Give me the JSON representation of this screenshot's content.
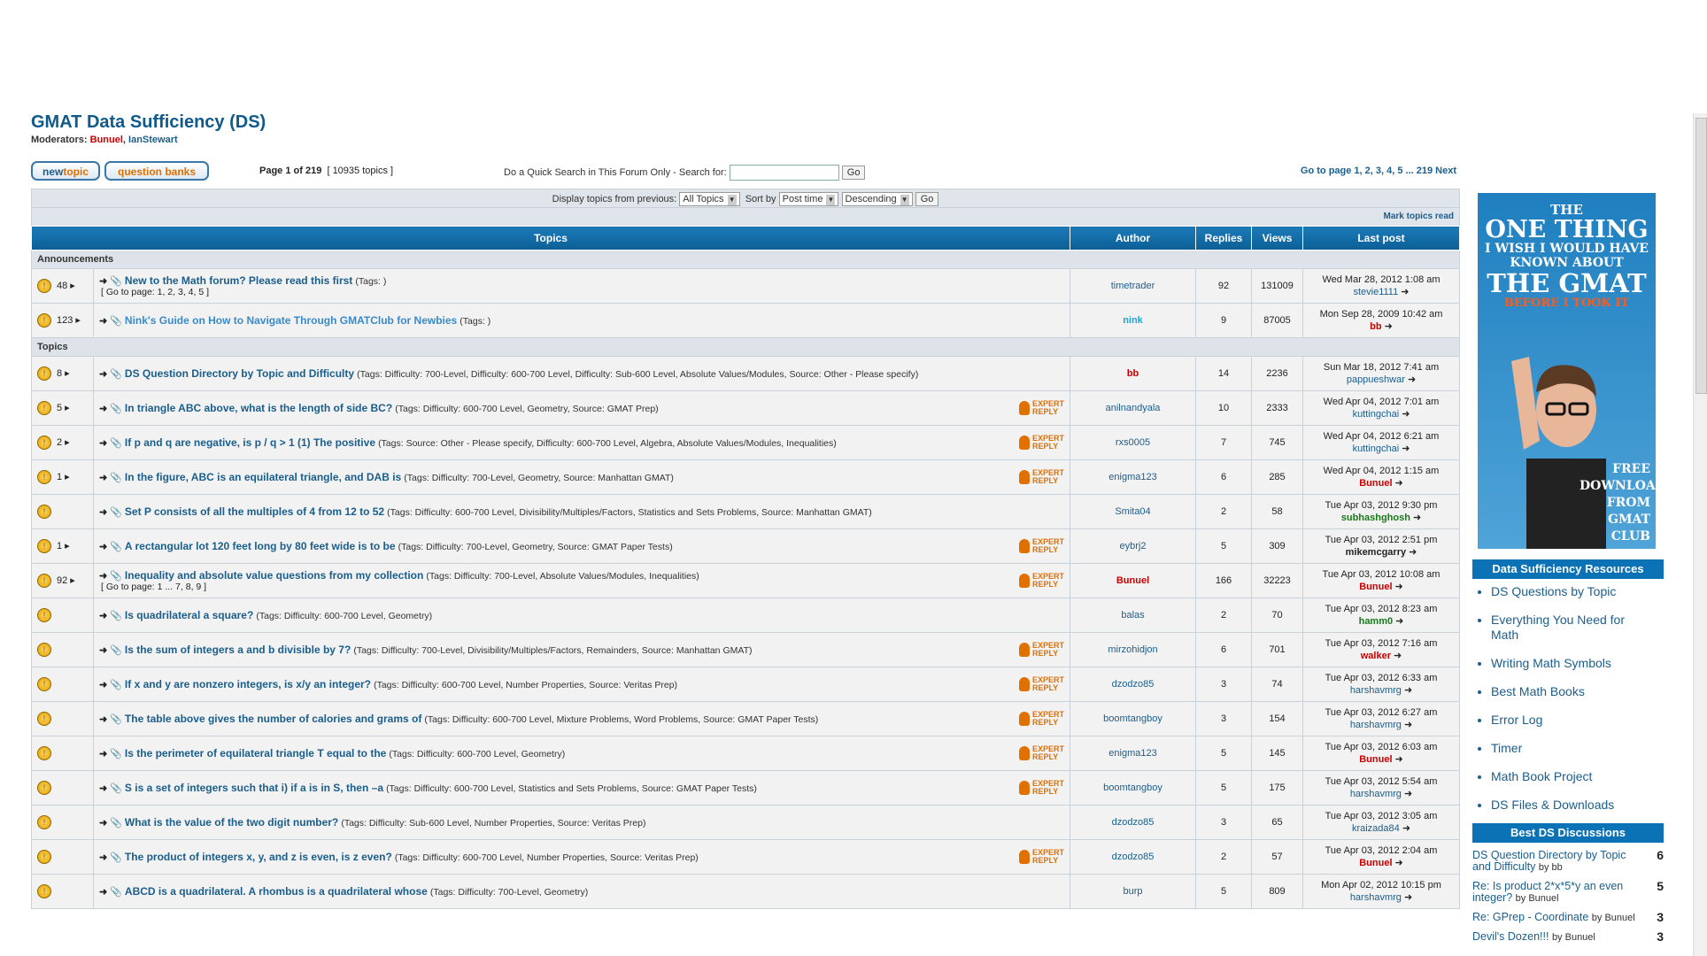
{
  "forum": {
    "title": "GMAT Data Sufficiency (DS)",
    "moderators_label": "Moderators:",
    "moderators": [
      "Bunuel",
      "IanStewart"
    ]
  },
  "buttons": {
    "newtopic_a": "new",
    "newtopic_b": "topic",
    "question_banks": "question banks"
  },
  "pageinfo": {
    "page_label": "Page 1 of 219",
    "topics_count": "[ 10935 topics ]"
  },
  "quicksearch": {
    "label": "Do a Quick Search in This Forum Only -  Search for:",
    "go": "Go"
  },
  "goto": {
    "text": "Go to page 1, 2, 3, 4, 5 ... 219  Next"
  },
  "filter": {
    "display_label": "Display topics from previous:",
    "period": "All Topics",
    "sort_label": "Sort by",
    "sort_by": "Post time",
    "order": "Descending",
    "go": "Go"
  },
  "mark_read": "Mark topics read",
  "columns": {
    "topics": "Topics",
    "author": "Author",
    "replies": "Replies",
    "views": "Views",
    "last_post": "Last post"
  },
  "sections": {
    "announcements": "Announcements",
    "topics": "Topics"
  },
  "announcements": [
    {
      "num": "48",
      "title": "New to the Math forum? Please read this first",
      "tags": "(Tags: )",
      "pages": "[ Go to page: 1, 2, 3, 4, 5 ]",
      "author": "timetrader",
      "replies": "92",
      "views": "131009",
      "date": "Wed Mar 28, 2012 1:08 am",
      "last_user": "stevie1111"
    },
    {
      "num": "123",
      "title": "Nink's Guide on How to Navigate Through GMATClub for Newbies",
      "tags": "(Tags: )",
      "author": "nink",
      "replies": "9",
      "views": "87005",
      "date": "Mon Sep 28, 2009 10:42 am",
      "last_user": "bb"
    }
  ],
  "topics": [
    {
      "num": "8",
      "title": "DS Question Directory by Topic and Difficulty",
      "tags": "(Tags: Difficulty: 700-Level, Difficulty: 600-700 Level, Difficulty: Sub-600 Level, Absolute Values/Modules, Source: Other - Please specify)",
      "expert": false,
      "author": "bb",
      "replies": "14",
      "views": "2236",
      "date": "Sun Mar 18, 2012 7:41 am",
      "last_user": "pappueshwar"
    },
    {
      "num": "5",
      "title": "In triangle ABC above, what is the length of side BC?",
      "tags": "(Tags: Difficulty: 600-700 Level, Geometry, Source: GMAT Prep)",
      "expert": true,
      "author": "anilnandyala",
      "replies": "10",
      "views": "2333",
      "date": "Wed Apr 04, 2012 7:01 am",
      "last_user": "kuttingchai"
    },
    {
      "num": "2",
      "title": "If p and q are negative, is p / q > 1 (1) The positive",
      "tags": "(Tags: Source: Other - Please specify, Difficulty: 600-700 Level, Algebra, Absolute Values/Modules, Inequalities)",
      "expert": true,
      "author": "rxs0005",
      "replies": "7",
      "views": "745",
      "date": "Wed Apr 04, 2012 6:21 am",
      "last_user": "kuttingchai"
    },
    {
      "num": "1",
      "title": "In the figure, ABC is an equilateral triangle, and DAB is",
      "tags": "(Tags: Difficulty: 700-Level, Geometry, Source: Manhattan GMAT)",
      "expert": true,
      "author": "enigma123",
      "replies": "6",
      "views": "285",
      "date": "Wed Apr 04, 2012 1:15 am",
      "last_user": "Bunuel"
    },
    {
      "num": "",
      "title": "Set P consists of all the multiples of 4 from 12 to 52",
      "tags": "(Tags: Difficulty: 600-700 Level, Divisibility/Multiples/Factors, Statistics and Sets Problems, Source: Manhattan GMAT)",
      "expert": false,
      "author": "Smita04",
      "replies": "2",
      "views": "58",
      "date": "Tue Apr 03, 2012 9:30 pm",
      "last_user": "subhashghosh"
    },
    {
      "num": "1",
      "title": "A rectangular lot 120 feet long by 80 feet wide is to be",
      "tags": "(Tags: Difficulty: 700-Level, Geometry, Source: GMAT Paper Tests)",
      "expert": true,
      "author": "eybrj2",
      "replies": "5",
      "views": "309",
      "date": "Tue Apr 03, 2012 2:51 pm",
      "last_user": "mikemcgarry"
    },
    {
      "num": "92",
      "title": "Inequality and absolute value questions from my collection",
      "tags": "(Tags: Difficulty: 700-Level, Absolute Values/Modules, Inequalities)",
      "pages": "[ Go to page: 1 ... 7, 8, 9 ]",
      "expert": true,
      "author": "Bunuel",
      "replies": "166",
      "views": "32223",
      "date": "Tue Apr 03, 2012 10:08 am",
      "last_user": "Bunuel"
    },
    {
      "num": "",
      "title": "Is quadrilateral a square?",
      "tags": "(Tags: Difficulty: 600-700 Level, Geometry)",
      "expert": false,
      "author": "balas",
      "replies": "2",
      "views": "70",
      "date": "Tue Apr 03, 2012 8:23 am",
      "last_user": "hamm0"
    },
    {
      "num": "",
      "title": "Is the sum of integers a and b divisible by 7?",
      "tags": "(Tags: Difficulty: 700-Level, Divisibility/Multiples/Factors, Remainders, Source: Manhattan GMAT)",
      "expert": true,
      "author": "mirzohidjon",
      "replies": "6",
      "views": "701",
      "date": "Tue Apr 03, 2012 7:16 am",
      "last_user": "walker"
    },
    {
      "num": "",
      "title": "If x and y are nonzero integers, is x/y an integer?",
      "tags": "(Tags: Difficulty: 600-700 Level, Number Properties, Source: Veritas Prep)",
      "expert": true,
      "author": "dzodzo85",
      "replies": "3",
      "views": "74",
      "date": "Tue Apr 03, 2012 6:33 am",
      "last_user": "harshavmrg"
    },
    {
      "num": "",
      "title": "The table above gives the number of calories and grams of",
      "tags": "(Tags: Difficulty: 600-700 Level, Mixture Problems, Word Problems, Source: GMAT Paper Tests)",
      "expert": true,
      "author": "boomtangboy",
      "replies": "3",
      "views": "154",
      "date": "Tue Apr 03, 2012 6:27 am",
      "last_user": "harshavmrg"
    },
    {
      "num": "",
      "title": "Is the perimeter of equilateral triangle T equal to the",
      "tags": "(Tags: Difficulty: 600-700 Level, Geometry)",
      "expert": true,
      "author": "enigma123",
      "replies": "5",
      "views": "145",
      "date": "Tue Apr 03, 2012 6:03 am",
      "last_user": "Bunuel"
    },
    {
      "num": "",
      "title": "S is a set of integers such that i) if a is in S, then –a",
      "tags": "(Tags: Difficulty: 600-700 Level, Statistics and Sets Problems, Source: GMAT Paper Tests)",
      "expert": true,
      "author": "boomtangboy",
      "replies": "5",
      "views": "175",
      "date": "Tue Apr 03, 2012 5:54 am",
      "last_user": "harshavmrg"
    },
    {
      "num": "",
      "title": "What is the value of the two digit number?",
      "tags": "(Tags: Difficulty: Sub-600 Level, Number Properties, Source: Veritas Prep)",
      "expert": false,
      "author": "dzodzo85",
      "replies": "3",
      "views": "65",
      "date": "Tue Apr 03, 2012 3:05 am",
      "last_user": "kraizada84"
    },
    {
      "num": "",
      "title": "The product of integers x, y, and z is even, is z even?",
      "tags": "(Tags: Difficulty: 600-700 Level, Number Properties, Source: Veritas Prep)",
      "expert": true,
      "author": "dzodzo85",
      "replies": "2",
      "views": "57",
      "date": "Tue Apr 03, 2012 2:04 am",
      "last_user": "Bunuel"
    },
    {
      "num": "",
      "title": "ABCD is a quadrilateral. A rhombus is a quadrilateral whose",
      "tags": "(Tags: Difficulty: 700-Level, Geometry)",
      "expert": false,
      "author": "burp",
      "replies": "5",
      "views": "809",
      "date": "Mon Apr 02, 2012 10:15 pm",
      "last_user": "harshavmrg"
    }
  ],
  "expert_reply": "EXPERT REPLY",
  "ad": {
    "line1": "THE",
    "line2": "ONE THING",
    "line3": "I WISH I WOULD HAVE KNOWN ABOUT",
    "line4": "THE GMAT",
    "line5": "BEFORE I TOOK IT",
    "free": "FREE DOWNLOAD FROM GMAT CLUB"
  },
  "resources": {
    "heading": "Data Sufficiency Resources",
    "items": [
      "DS Questions by Topic",
      "Everything You Need for Math",
      "Writing Math Symbols",
      "Best Math Books",
      "Error Log",
      "Timer",
      "Math Book Project",
      "DS Files & Downloads"
    ]
  },
  "discussions": {
    "heading": "Best DS Discussions",
    "items": [
      {
        "title": "DS Question Directory by Topic and Difficulty",
        "by": "by bb",
        "count": "6"
      },
      {
        "title": "Re: Is product 2*x*5*y an even integer?",
        "by": "by Bunuel",
        "count": "5"
      },
      {
        "title": "Re: GPrep - Coordinate",
        "by": "by Bunuel",
        "count": "3"
      },
      {
        "title": "Devil's Dozen!!!",
        "by": "by Bunuel",
        "count": "3"
      }
    ]
  }
}
